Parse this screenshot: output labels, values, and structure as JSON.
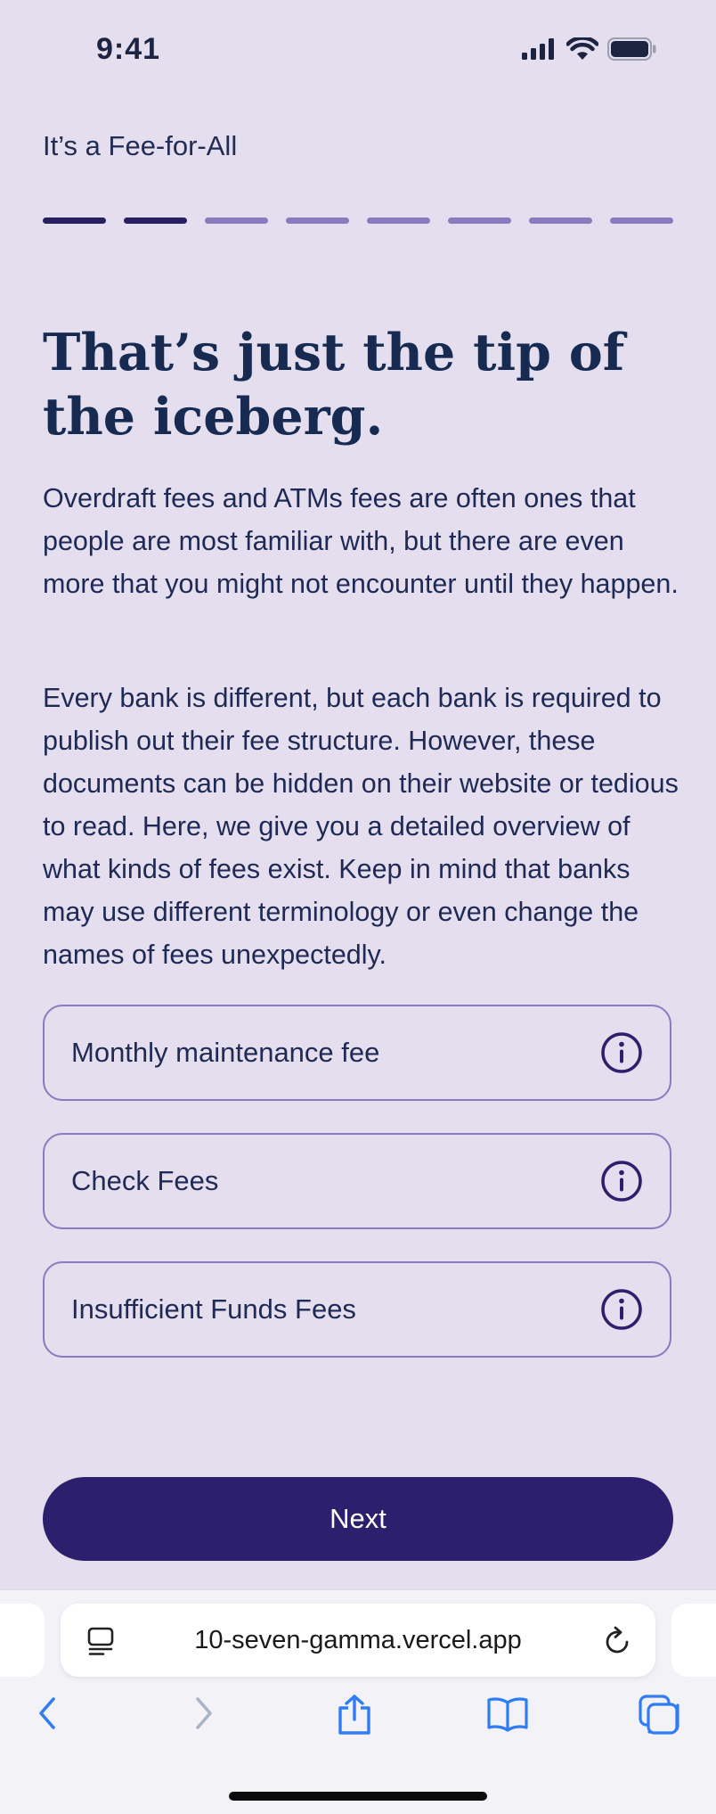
{
  "status_bar": {
    "time": "9:41"
  },
  "header": {
    "kicker": "It’s a Fee-for-All"
  },
  "progress": {
    "total_steps": 8,
    "completed_steps": 2
  },
  "content": {
    "headline": "That’s just the tip of the iceberg.",
    "paragraphs": [
      "Overdraft fees and ATMs fees are often ones that people are most familiar with, but there are even more that you might not encounter until they happen.",
      "Every bank is different, but each bank is required to publish out their fee structure. However, these documents can be hidden on their website or tedious to read. Here, we give you a detailed overview of what kinds of fees exist. Keep in mind that banks may use different terminology or even change the names of fees unexpectedly."
    ],
    "fee_items": [
      {
        "label": "Monthly maintenance fee",
        "icon": "info-icon"
      },
      {
        "label": "Check Fees",
        "icon": "info-icon"
      },
      {
        "label": "Insufficient Funds Fees",
        "icon": "info-icon"
      }
    ],
    "next_label": "Next"
  },
  "browser": {
    "url": "10-seven-gamma.vercel.app",
    "toolbar_icons": [
      "back-icon",
      "forward-icon",
      "share-icon",
      "bookmarks-icon",
      "tabs-icon"
    ]
  },
  "colors": {
    "background": "#e4deee",
    "accent": "#2c1f6e",
    "progress_done": "#25205f",
    "progress_todo": "#8a7bbf",
    "text": "#1e2a55",
    "safari_blue": "#2f7cf6"
  }
}
